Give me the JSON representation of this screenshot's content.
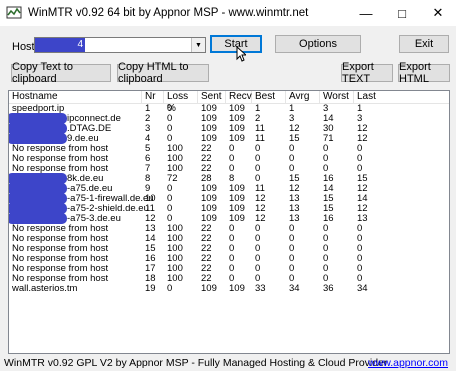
{
  "window": {
    "title": "WinMTR v0.92 64 bit by Appnor MSP - www.winmtr.net",
    "controls": [
      "minimize-icon",
      "maximize-icon",
      "close-icon"
    ]
  },
  "toolbar": {
    "host_label": "Host:",
    "host_value": "4",
    "start_label": "Start",
    "options_label": "Options",
    "exit_label": "Exit",
    "copy_text_label": "Copy Text to clipboard",
    "copy_html_label": "Copy HTML to clipboard",
    "export_text_label": "Export TEXT",
    "export_html_label": "Export HTML"
  },
  "table": {
    "headers": [
      "Hostname",
      "Nr",
      "Loss %",
      "Sent",
      "Recv",
      "Best",
      "Avrg",
      "Worst",
      "Last"
    ],
    "rows": [
      {
        "host": "speedport.ip",
        "nr": "1",
        "loss": "0",
        "sent": "109",
        "recv": "109",
        "best": "1",
        "avrg": "1",
        "worst": "3",
        "last": "1",
        "redact": false
      },
      {
        "host": "ipconnect.de",
        "nr": "2",
        "loss": "0",
        "sent": "109",
        "recv": "109",
        "best": "2",
        "avrg": "3",
        "worst": "14",
        "last": "3",
        "redact": true
      },
      {
        "host": ".DTAG.DE",
        "nr": "3",
        "loss": "0",
        "sent": "109",
        "recv": "109",
        "best": "11",
        "avrg": "12",
        "worst": "30",
        "last": "12",
        "redact": true
      },
      {
        "host": "9.de.eu",
        "nr": "4",
        "loss": "0",
        "sent": "109",
        "recv": "109",
        "best": "11",
        "avrg": "15",
        "worst": "71",
        "last": "12",
        "redact": true
      },
      {
        "host": "No response from host",
        "nr": "5",
        "loss": "100",
        "sent": "22",
        "recv": "0",
        "best": "0",
        "avrg": "0",
        "worst": "0",
        "last": "0",
        "redact": false
      },
      {
        "host": "No response from host",
        "nr": "6",
        "loss": "100",
        "sent": "22",
        "recv": "0",
        "best": "0",
        "avrg": "0",
        "worst": "0",
        "last": "0",
        "redact": false
      },
      {
        "host": "No response from host",
        "nr": "7",
        "loss": "100",
        "sent": "22",
        "recv": "0",
        "best": "0",
        "avrg": "0",
        "worst": "0",
        "last": "0",
        "redact": false
      },
      {
        "host": "8k.de.eu",
        "nr": "8",
        "loss": "72",
        "sent": "28",
        "recv": "8",
        "best": "0",
        "avrg": "15",
        "worst": "16",
        "last": "15",
        "redact": true
      },
      {
        "host": "-a75.de.eu",
        "nr": "9",
        "loss": "0",
        "sent": "109",
        "recv": "109",
        "best": "11",
        "avrg": "12",
        "worst": "14",
        "last": "12",
        "redact": true
      },
      {
        "host": "-a75-1-firewall.de.eu",
        "nr": "10",
        "loss": "0",
        "sent": "109",
        "recv": "109",
        "best": "12",
        "avrg": "13",
        "worst": "15",
        "last": "14",
        "redact": true
      },
      {
        "host": "-a75-2-shield.de.eu",
        "nr": "11",
        "loss": "0",
        "sent": "109",
        "recv": "109",
        "best": "12",
        "avrg": "13",
        "worst": "15",
        "last": "12",
        "redact": true
      },
      {
        "host": "-a75-3.de.eu",
        "nr": "12",
        "loss": "0",
        "sent": "109",
        "recv": "109",
        "best": "12",
        "avrg": "13",
        "worst": "16",
        "last": "13",
        "redact": true
      },
      {
        "host": "No response from host",
        "nr": "13",
        "loss": "100",
        "sent": "22",
        "recv": "0",
        "best": "0",
        "avrg": "0",
        "worst": "0",
        "last": "0",
        "redact": false
      },
      {
        "host": "No response from host",
        "nr": "14",
        "loss": "100",
        "sent": "22",
        "recv": "0",
        "best": "0",
        "avrg": "0",
        "worst": "0",
        "last": "0",
        "redact": false
      },
      {
        "host": "No response from host",
        "nr": "15",
        "loss": "100",
        "sent": "22",
        "recv": "0",
        "best": "0",
        "avrg": "0",
        "worst": "0",
        "last": "0",
        "redact": false
      },
      {
        "host": "No response from host",
        "nr": "16",
        "loss": "100",
        "sent": "22",
        "recv": "0",
        "best": "0",
        "avrg": "0",
        "worst": "0",
        "last": "0",
        "redact": false
      },
      {
        "host": "No response from host",
        "nr": "17",
        "loss": "100",
        "sent": "22",
        "recv": "0",
        "best": "0",
        "avrg": "0",
        "worst": "0",
        "last": "0",
        "redact": false
      },
      {
        "host": "No response from host",
        "nr": "18",
        "loss": "100",
        "sent": "22",
        "recv": "0",
        "best": "0",
        "avrg": "0",
        "worst": "0",
        "last": "0",
        "redact": false
      },
      {
        "host": "wall.asterios.tm",
        "nr": "19",
        "loss": "0",
        "sent": "109",
        "recv": "109",
        "best": "33",
        "avrg": "34",
        "worst": "36",
        "last": "34",
        "redact": false
      }
    ]
  },
  "statusbar": {
    "text": "WinMTR v0.92 GPL V2 by Appnor MSP - Fully Managed Hosting & Cloud Provider",
    "link": "www.appnor.com"
  },
  "colors": {
    "redaction": "#3d45c9",
    "link": "#0000ff",
    "focus": "#0078d7"
  }
}
